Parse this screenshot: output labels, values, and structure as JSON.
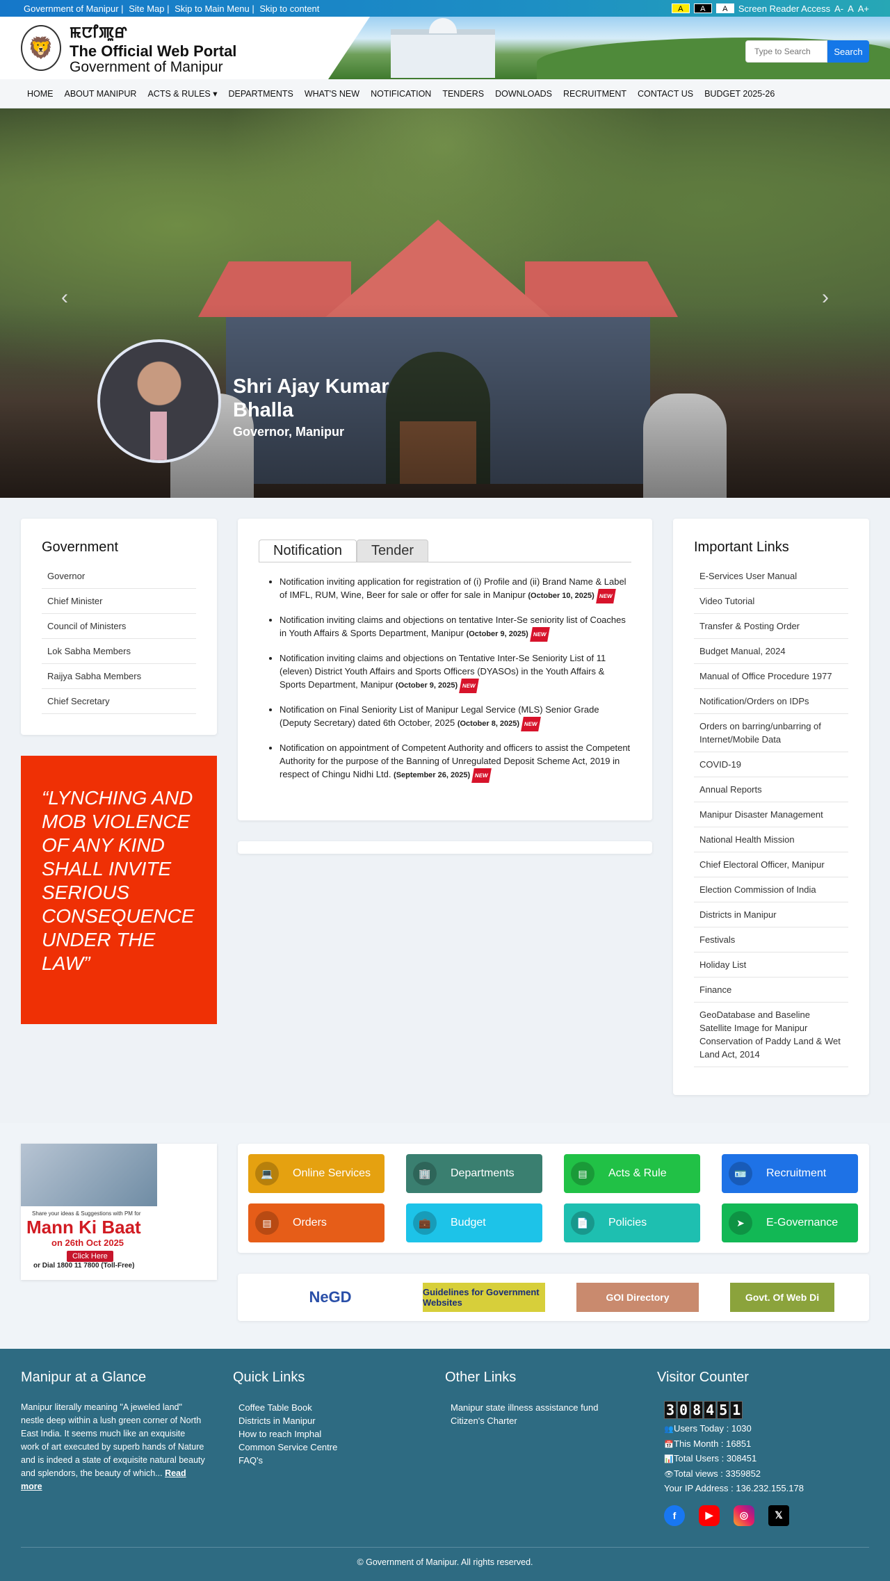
{
  "topbar": {
    "gov": "Government of Manipur |",
    "sitemap": "Site Map |",
    "skip_main": "Skip to Main Menu |",
    "skip_content": "Skip to content",
    "contrast": [
      "A",
      "A",
      "A"
    ],
    "screen_reader": "Screen Reader Access",
    "font_sizes": [
      "A-",
      "A",
      "A+"
    ]
  },
  "header": {
    "script": "ꯃꯅꯤꯄꯨꯔ",
    "title1": "The Official Web Portal",
    "title2": "Government of Manipur",
    "search_placeholder": "Type to Search",
    "search_button": "Search"
  },
  "nav": [
    "HOME",
    "ABOUT MANIPUR",
    "ACTS & RULES ▾",
    "DEPARTMENTS",
    "WHAT'S NEW",
    "NOTIFICATION",
    "TENDERS",
    "DOWNLOADS",
    "RECRUITMENT",
    "CONTACT US",
    "BUDGET 2025-26"
  ],
  "hero": {
    "name": "Shri Ajay Kumar Bhalla",
    "title": "Governor, Manipur"
  },
  "government": {
    "heading": "Government",
    "items": [
      "Governor",
      "Chief Minister",
      "Council of Ministers",
      "Lok Sabha Members",
      "Raijya Sabha Members",
      "Chief Secretary"
    ]
  },
  "quote": "“LYNCHING AND MOB VIOLENCE OF ANY KIND SHALL INVITE SERIOUS CONSEQUENCE UNDER THE LAW”",
  "tabs": [
    "Notification",
    "Tender"
  ],
  "notifications": [
    {
      "text": "Notification inviting application for registration of (i) Profile and (ii) Brand Name & Label of IMFL, RUM, Wine, Beer for sale or offer for sale in Manipur ",
      "date": "(October 10, 2025)"
    },
    {
      "text": "Notification inviting claims and objections on tentative Inter-Se seniority list of Coaches in Youth Affairs & Sports Department, Manipur ",
      "date": "(October 9, 2025)"
    },
    {
      "text": "Notification inviting claims and objections on Tentative Inter-Se Seniority List of 11 (eleven) District Youth Affairs and Sports Officers (DYASOs) in the Youth Affairs & Sports Department, Manipur ",
      "date": "(October 9, 2025)"
    },
    {
      "text": "Notification on Final Seniority List of Manipur Legal Service (MLS) Senior Grade (Deputy Secretary) dated 6th October, 2025 ",
      "date": "(October 8, 2025)"
    },
    {
      "text": "Notification on appointment of Competent Authority and officers to assist the Competent Authority for the purpose of the Banning of Unregulated Deposit Scheme Act, 2019 in respect of Chingu Nidhi Ltd. ",
      "date": "(September 26, 2025)"
    }
  ],
  "new_badge": "NEW",
  "important": {
    "heading": "Important Links",
    "items": [
      "E-Services User Manual",
      "Video Tutorial",
      "Transfer & Posting Order",
      "Budget Manual, 2024",
      "Manual of Office Procedure 1977",
      "Notification/Orders on IDPs",
      "Orders on barring/unbarring of Internet/Mobile Data",
      "COVID-19",
      "Annual Reports",
      "Manipur Disaster Management",
      "National Health Mission",
      "Chief Electoral Officer, Manipur",
      "Election Commission of India",
      "Districts in Manipur",
      "Festivals",
      "Holiday List",
      "Finance",
      "GeoDatabase and Baseline Satellite Image for Manipur Conservation of Paddy Land & Wet Land Act, 2014"
    ]
  },
  "mkb": {
    "line1": "Share your ideas & Suggestions with PM for",
    "title": "Mann Ki Baat",
    "date": "on 26th Oct 2025",
    "click": "Click Here",
    "dial": "or Dial 1800 11 7800 (Toll-Free)"
  },
  "services": [
    {
      "label": "Online Services",
      "color": "#e5a110",
      "icon": "💻"
    },
    {
      "label": "Departments",
      "color": "#3a7f70",
      "icon": "🏢"
    },
    {
      "label": "Acts & Rule",
      "color": "#21c146",
      "icon": "▤"
    },
    {
      "label": "Recruitment",
      "color": "#1e72e6",
      "icon": "🪪"
    },
    {
      "label": "Orders",
      "color": "#e65d18",
      "icon": "▤"
    },
    {
      "label": "Budget",
      "color": "#1dc3e8",
      "icon": "💼"
    },
    {
      "label": "Policies",
      "color": "#1ebfb0",
      "icon": "📄"
    },
    {
      "label": "E-Governance",
      "color": "#12b855",
      "icon": "➤"
    }
  ],
  "logos": [
    "NeGD",
    "Guidelines for Government Websites",
    "GOI Directory",
    "Govt. Of Web Di"
  ],
  "footer": {
    "glance_h": "Manipur at a Glance",
    "glance_p": "Manipur literally meaning \"A jeweled land\" nestle deep within a lush green corner of North East India. It seems much like an exquisite  work of art  executed by superb hands of Nature and is indeed a state of exquisite natural beauty and splendors, the beauty of which... ",
    "read_more": "Read more",
    "quick_h": "Quick Links",
    "quick": [
      "Coffee Table Book",
      "Districts in Manipur",
      "How to reach Imphal",
      "Common Service Centre",
      "FAQ's"
    ],
    "other_h": "Other Links",
    "other": [
      "Manipur state illness assistance fund",
      "Citizen's Charter"
    ],
    "visitor_h": "Visitor Counter",
    "counter": [
      "3",
      "0",
      "8",
      "4",
      "5",
      "1"
    ],
    "stats": [
      "Users Today : 1030",
      "This Month : 16851",
      "Total Users : 308451",
      "Total views : 3359852",
      "Your IP Address : 136.232.155.178"
    ],
    "copyright": "© Government of Manipur. All rights reserved."
  }
}
